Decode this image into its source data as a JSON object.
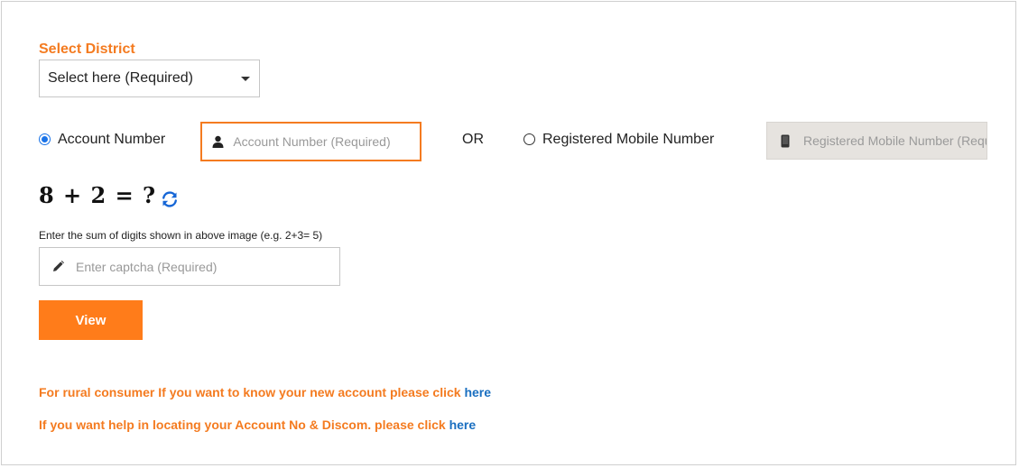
{
  "district": {
    "label": "Select District",
    "selected": "Select here (Required)"
  },
  "lookup": {
    "account_option_label": "Account Number",
    "account_placeholder": "Account Number (Required)",
    "or_text": "OR",
    "mobile_option_label": "Registered Mobile Number",
    "mobile_placeholder": "Registered Mobile Number (Required)"
  },
  "captcha": {
    "expression": "8 + 2 = ?",
    "hint": "Enter the sum of digits shown in above image (e.g. 2+3= 5)",
    "placeholder": "Enter captcha (Required)"
  },
  "actions": {
    "view_label": "View"
  },
  "notes": [
    {
      "text": "For rural consumer If you want to know your new account please click ",
      "link": "here"
    },
    {
      "text": "If you want help in locating your Account No & Discom. please click ",
      "link": "here"
    }
  ],
  "colors": {
    "accent": "#f47b20",
    "button": "#ff7c1a",
    "link": "#1a6fc0",
    "radio": "#1a73e8"
  }
}
